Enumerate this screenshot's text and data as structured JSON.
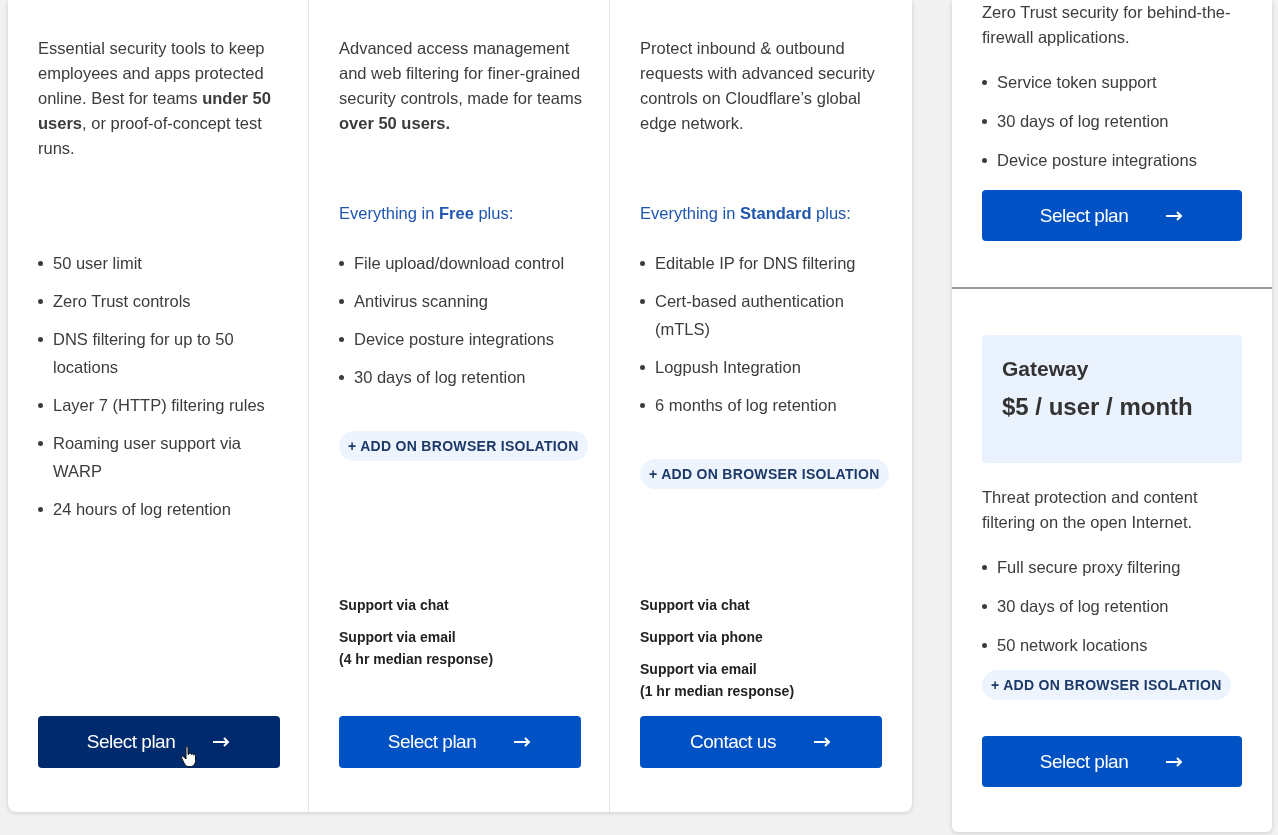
{
  "plans": [
    {
      "description": "Essential security tools to keep employees and apps protected online. Best for teams **under 50 users**, or proof-of-concept test runs.",
      "features": [
        "50 user limit",
        "Zero Trust controls",
        "DNS filtering for up to 50 locations",
        "Layer 7 (HTTP) filtering rules",
        "Roaming user support via WARP",
        "24 hours of log retention"
      ],
      "button": {
        "label": "Select plan",
        "hovered": true
      }
    },
    {
      "description": "Advanced access management and web filtering for finer-grained security controls, made for teams **over 50 users.**",
      "includes": "Everything in **Free** plus:",
      "features": [
        "File upload/download control",
        "Antivirus scanning",
        "Device posture integrations",
        "30 days of log retention"
      ],
      "addon": "+ ADD ON BROWSER ISOLATION",
      "support": [
        "Support via chat",
        "Support via email\n(4 hr median response)"
      ],
      "button": {
        "label": "Select plan",
        "hovered": false
      }
    },
    {
      "description": "Protect inbound & outbound requests with advanced security controls on Cloudflare’s global edge network.",
      "includes": "Everything in **Standard** plus:",
      "features": [
        "Editable IP for DNS filtering",
        "Cert-based authentication (mTLS)",
        "Logpush Integration",
        "6 months of log retention"
      ],
      "addon": "+ ADD ON BROWSER ISOLATION",
      "support": [
        "Support via chat",
        "Support via phone",
        "Support via email\n(1 hr median response)"
      ],
      "button": {
        "label": "Contact us",
        "hovered": false
      }
    }
  ],
  "side_plans": [
    {
      "description": "Zero Trust security for behind-the-firewall applications.",
      "features": [
        "Service token support",
        "30 days of log retention",
        "Device posture integrations"
      ],
      "button": {
        "label": "Select plan",
        "hovered": false
      }
    },
    {
      "name": "Gateway",
      "price": "$5 / user / month",
      "description": "Threat protection and content filtering on the open Internet.",
      "features": [
        "Full secure proxy filtering",
        "30 days of log retention",
        "50 network locations"
      ],
      "addon": "+ ADD ON BROWSER ISOLATION",
      "button": {
        "label": "Select plan",
        "hovered": false
      }
    }
  ]
}
